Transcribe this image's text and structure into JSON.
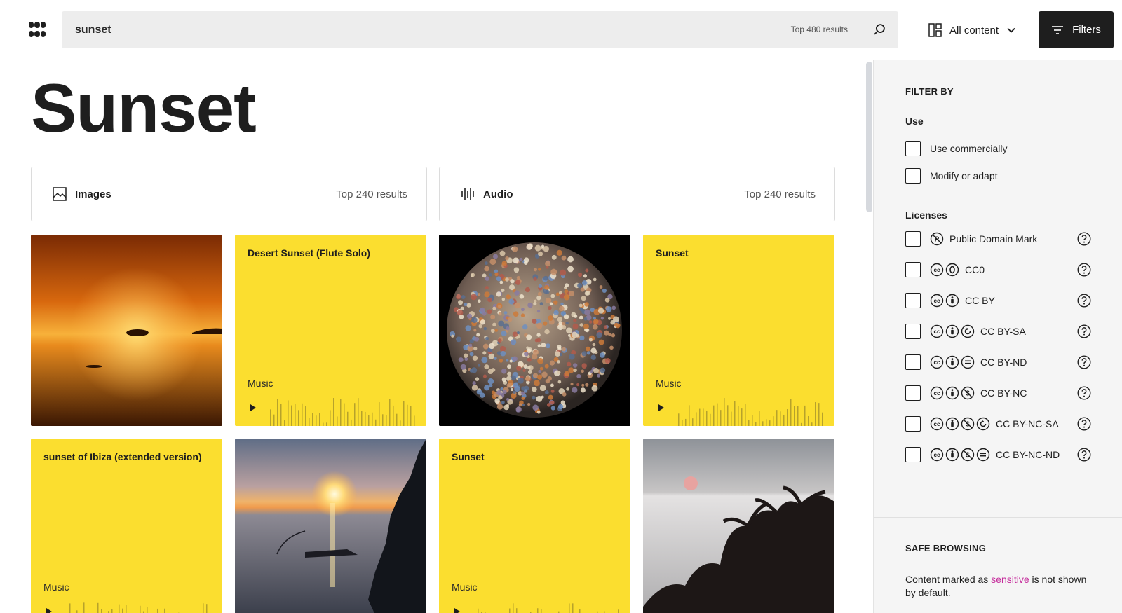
{
  "header": {
    "search_value": "sunset",
    "search_count": "Top 480 results",
    "content_type": "All content",
    "filters_label": "Filters"
  },
  "page_title": "Sunset",
  "type_cards": [
    {
      "label": "Images",
      "count": "Top 240 results"
    },
    {
      "label": "Audio",
      "count": "Top 240 results"
    }
  ],
  "results": [
    {
      "kind": "image",
      "scene": "orange sunset over sea with island"
    },
    {
      "kind": "audio",
      "title": "Desert Sunset (Flute Solo)",
      "category": "Music"
    },
    {
      "kind": "image",
      "scene": "sphere of colorful beads on black"
    },
    {
      "kind": "audio",
      "title": "Sunset",
      "category": "Music"
    },
    {
      "kind": "audio",
      "title": "sunset of Ibiza (extended version)",
      "category": "Music"
    },
    {
      "kind": "image",
      "scene": "sunset over sea beside cliff"
    },
    {
      "kind": "audio",
      "title": "Sunset",
      "category": "Music"
    },
    {
      "kind": "image",
      "scene": "palm trees silhouette at dusk"
    }
  ],
  "sidebar": {
    "filter_by": "FILTER BY",
    "use_heading": "Use",
    "use_options": [
      "Use commercially",
      "Modify or adapt"
    ],
    "licenses_heading": "Licenses",
    "licenses": [
      {
        "label": "Public Domain Mark",
        "icons": [
          "pdm-icon"
        ]
      },
      {
        "label": "CC0",
        "icons": [
          "cc-icon",
          "zero-icon"
        ]
      },
      {
        "label": "CC BY",
        "icons": [
          "cc-icon",
          "by-icon"
        ]
      },
      {
        "label": "CC BY-SA",
        "icons": [
          "cc-icon",
          "by-icon",
          "sa-icon"
        ]
      },
      {
        "label": "CC BY-ND",
        "icons": [
          "cc-icon",
          "by-icon",
          "nd-icon"
        ]
      },
      {
        "label": "CC BY-NC",
        "icons": [
          "cc-icon",
          "by-icon",
          "nc-icon"
        ]
      },
      {
        "label": "CC BY-NC-SA",
        "icons": [
          "cc-icon",
          "by-icon",
          "nc-icon",
          "sa-icon"
        ]
      },
      {
        "label": "CC BY-NC-ND",
        "icons": [
          "cc-icon",
          "by-icon",
          "nc-icon",
          "nd-icon"
        ]
      }
    ],
    "safe_heading": "SAFE BROWSING",
    "safe_text_before": "Content marked as ",
    "safe_link": "sensitive",
    "safe_text_after": " is not shown by default."
  },
  "colors": {
    "audio_tile": "#fbde2f",
    "dark": "#1e1e1e",
    "link": "#c52b9b"
  }
}
